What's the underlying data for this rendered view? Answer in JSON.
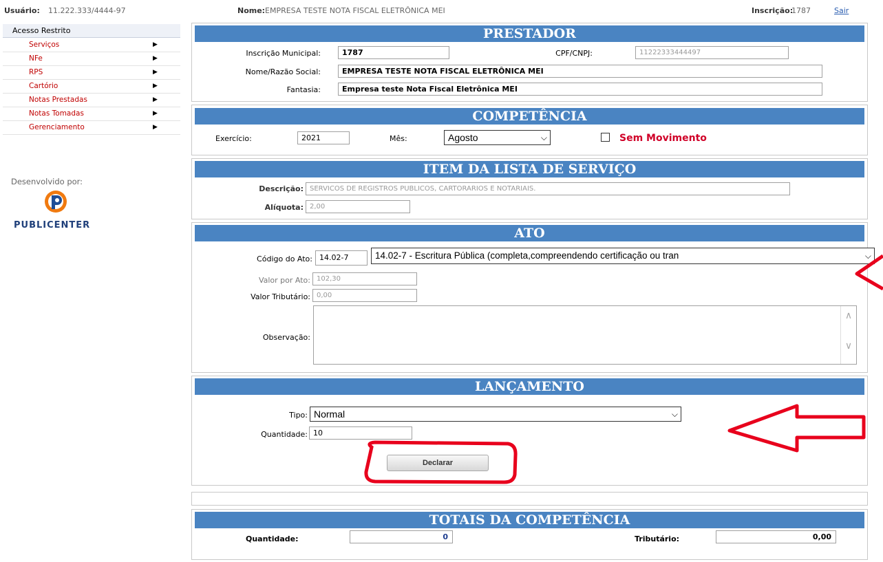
{
  "header": {
    "usuario_label": "Usuário:",
    "usuario_value": "11.222.333/4444-97",
    "nome_label": "Nome:",
    "nome_value": "EMPRESA TESTE NOTA FISCAL ELETRÔNICA MEI",
    "inscricao_label": "Inscrição:",
    "inscricao_value": "1787",
    "sair": "Sair"
  },
  "sidebar": {
    "title": "Acesso Restrito",
    "items": [
      {
        "label": "Serviços"
      },
      {
        "label": "NFe"
      },
      {
        "label": "RPS"
      },
      {
        "label": "Cartório"
      },
      {
        "label": "Notas Prestadas"
      },
      {
        "label": "Notas Tomadas"
      },
      {
        "label": "Gerenciamento"
      }
    ],
    "arrow": "▶",
    "dev_label": "Desenvolvido por:",
    "brand": "PUBLICENTER"
  },
  "prestador": {
    "title": "PRESTADOR",
    "inscricao_label": "Inscrição Municipal:",
    "inscricao_value": "1787",
    "cpf_label": "CPF/CNPJ:",
    "cpf_value": "11222333444497",
    "nome_label": "Nome/Razão Social:",
    "nome_value": "EMPRESA TESTE NOTA FISCAL ELETRÔNICA MEI",
    "fantasia_label": "Fantasia:",
    "fantasia_value": "Empresa teste Nota Fiscal Eletrônica MEI"
  },
  "competencia": {
    "title": "COMPETÊNCIA",
    "exercicio_label": "Exercício:",
    "exercicio_value": "2021",
    "mes_label": "Mês:",
    "mes_value": "Agosto",
    "sem_mov_label": "Sem Movimento",
    "sem_mov_checked": false
  },
  "item_servico": {
    "title": "ITEM DA LISTA DE SERVIÇO",
    "descricao_label": "Descrição:",
    "descricao_value": "SERVICOS DE REGISTROS PUBLICOS, CARTORARIOS E NOTARIAIS.",
    "aliquota_label": "Alíquota:",
    "aliquota_value": "2,00"
  },
  "ato": {
    "title": "ATO",
    "codigo_label": "Código do Ato:",
    "codigo_value": "14.02-7",
    "codigo_select": "14.02-7 - Escritura Pública (completa,compreendendo certificação ou tran",
    "valor_ato_label": "Valor por Ato:",
    "valor_ato_value": "102,30",
    "valor_trib_label": "Valor Tributário:",
    "valor_trib_value": "0,00",
    "obs_label": "Observação:",
    "obs_value": ""
  },
  "lancamento": {
    "title": "LANÇAMENTO",
    "tipo_label": "Tipo:",
    "tipo_value": "Normal",
    "quantidade_label": "Quantidade:",
    "quantidade_value": "10",
    "declarar_label": "Declarar"
  },
  "totais": {
    "title": "TOTAIS DA COMPETÊNCIA",
    "quantidade_label": "Quantidade:",
    "quantidade_value": "0",
    "tributario_label": "Tributário:",
    "tributario_value": "0,00"
  },
  "colors": {
    "header_blue": "#4a84c2",
    "menu_red": "#c00000",
    "annotation_red": "#e8001c"
  }
}
